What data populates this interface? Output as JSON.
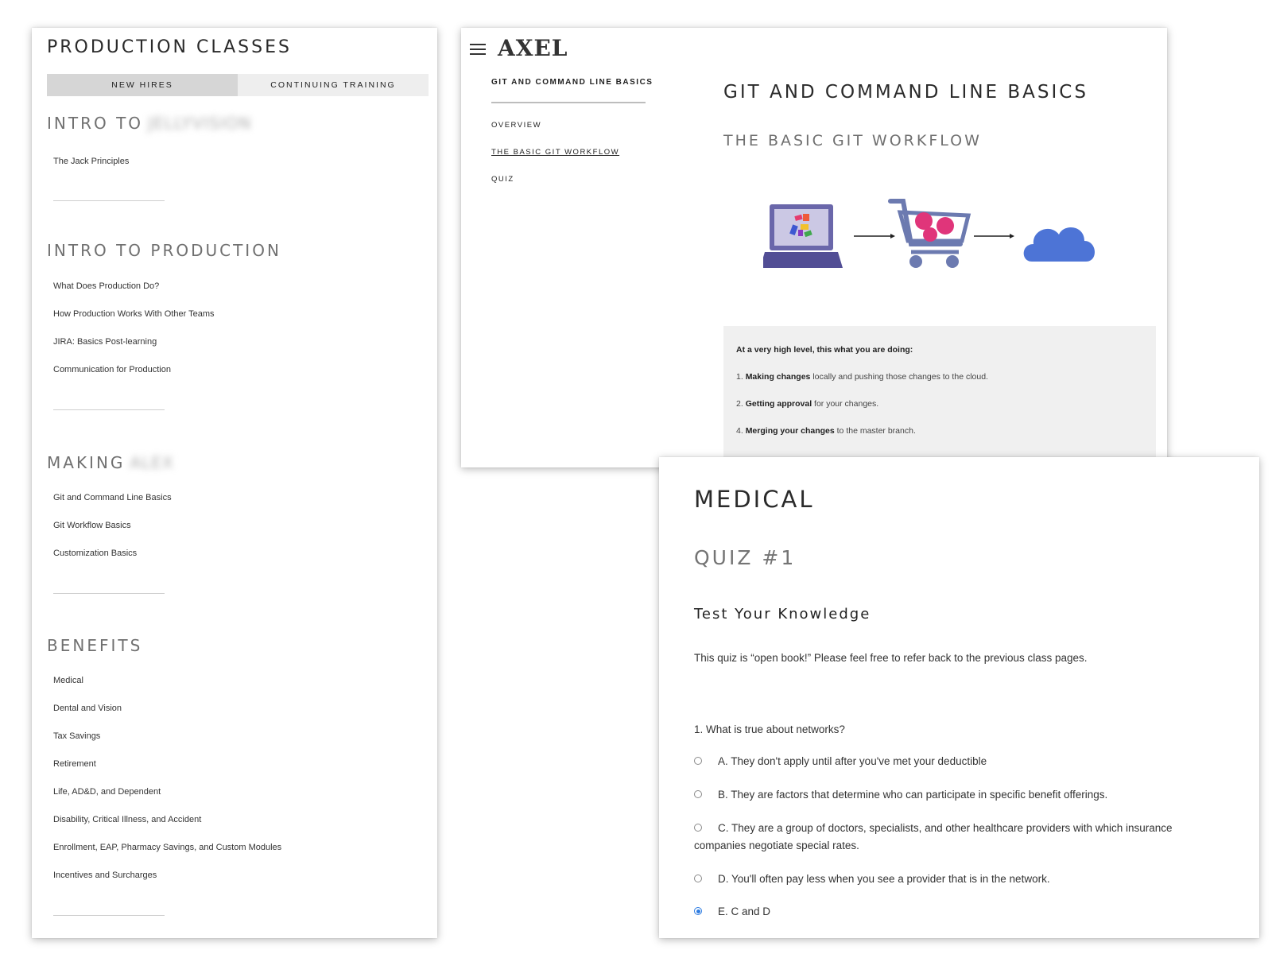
{
  "production_classes": {
    "title": "PRODUCTION CLASSES",
    "tabs": [
      {
        "label": "NEW HIRES",
        "active": true
      },
      {
        "label": "CONTINUING TRAINING",
        "active": false
      }
    ],
    "sections": [
      {
        "title": "INTRO TO",
        "title_blurred": "JELLYVISION",
        "items": [
          "The Jack Principles"
        ]
      },
      {
        "title": "INTRO TO PRODUCTION",
        "items": [
          "What Does Production Do?",
          "How Production Works With Other Teams",
          "JIRA: Basics Post-learning",
          "Communication for Production"
        ]
      },
      {
        "title": "MAKING",
        "title_blurred": "ALEX",
        "items": [
          "Git and Command Line Basics",
          "Git Workflow Basics",
          "Customization Basics"
        ]
      },
      {
        "title": "BENEFITS",
        "items": [
          "Medical",
          "Dental and Vision",
          "Tax Savings",
          "Retirement",
          "Life, AD&D, and Dependent",
          "Disability, Critical Illness, and Accident",
          "Enrollment, EAP, Pharmacy Savings, and Custom Modules",
          "Incentives and Surcharges"
        ]
      }
    ]
  },
  "git_page": {
    "logo": "AXEL",
    "nav_title": "GIT AND COMMAND LINE BASICS",
    "nav_items": [
      {
        "label": "OVERVIEW",
        "current": false
      },
      {
        "label": "THE BASIC GIT WORKFLOW",
        "current": true
      },
      {
        "label": "QUIZ",
        "current": false
      }
    ],
    "heading": "GIT AND COMMAND LINE BASICS",
    "subheading": "THE BASIC GIT WORKFLOW",
    "info_lead": "At a very high level, this what you are doing:",
    "steps": [
      {
        "num": "1.",
        "bold": "Making changes",
        "rest": "locally and pushing those changes to the cloud."
      },
      {
        "num": "2.",
        "bold": "Getting approval",
        "rest": "for your changes."
      },
      {
        "num": "4.",
        "bold": "Merging your changes",
        "rest": "to the master branch."
      }
    ]
  },
  "medical_quiz": {
    "title": "MEDICAL",
    "subtitle": "QUIZ #1",
    "section_title": "Test Your Knowledge",
    "intro": "This quiz is “open book!” Please feel free to refer back to the previous class pages.",
    "question": "1. What is true about networks?",
    "options": [
      {
        "text": "A. They don't apply until after you've met your deductible",
        "selected": false
      },
      {
        "text": "B. They are factors that determine who can participate in specific benefit offerings.",
        "selected": false
      },
      {
        "text": "C. They are a group of doctors, specialists, and other healthcare providers with which insurance companies negotiate special rates.",
        "selected": false
      },
      {
        "text": "D. You'll often pay less when you see a provider that is in the network.",
        "selected": false
      },
      {
        "text": "E. C and D",
        "selected": true
      }
    ]
  },
  "colors": {
    "accent_radio": "#2f7de1",
    "heading_gray": "#707070",
    "tab_active_bg": "#d6d6d6",
    "tab_inactive_bg": "#eeeeee",
    "infobox_bg": "#f0f0f0",
    "laptop": "#5e5a9e",
    "cart": "#6c7ab0",
    "cart_items": "#e0357a",
    "cloud": "#4d74d6"
  },
  "icons": [
    "hamburger-menu-icon",
    "laptop-icon",
    "arrow-right-icon",
    "shopping-cart-icon",
    "cloud-icon"
  ]
}
